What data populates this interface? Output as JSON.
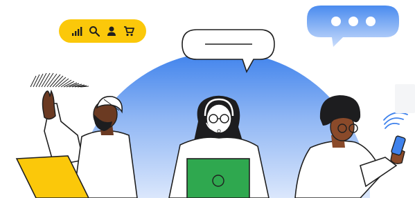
{
  "colors": {
    "blue_light": "#cfe0fb",
    "blue_dark": "#3f82ec",
    "yellow": "#fbc80a",
    "green": "#2fa84f",
    "skin_dark": "#6b3a22",
    "skin_mid": "#8a4a2a",
    "hair": "#1d1d1f",
    "stroke": "#1f1f1f",
    "white": "#ffffff"
  },
  "status_pill": {
    "icons": [
      "signal-icon",
      "search-icon",
      "person-icon",
      "cart-icon"
    ]
  },
  "chat_bubble": {
    "icon": "typing-dots-icon",
    "dot_count": 3
  },
  "figures": [
    "person-with-laptop",
    "person-with-headset",
    "person-with-phone"
  ],
  "decor": [
    "wifi-waves-icon",
    "hatch-lines"
  ]
}
